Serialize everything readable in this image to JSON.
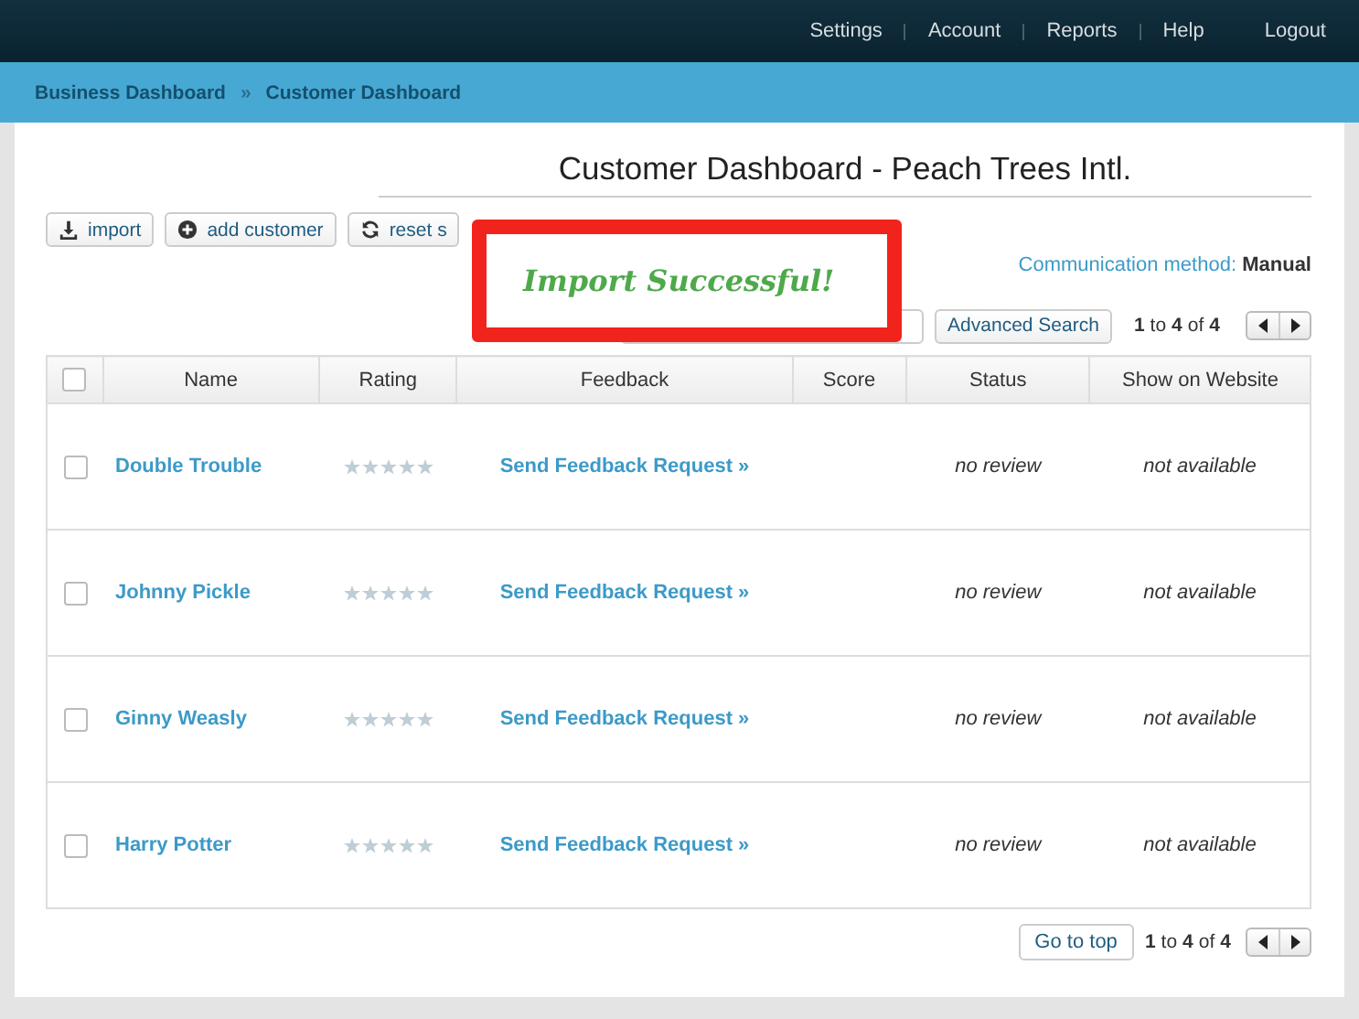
{
  "top_nav": [
    "Settings",
    "Account",
    "Reports",
    "Help",
    "Logout"
  ],
  "breadcrumb": [
    "Business Dashboard",
    "»",
    "Customer Dashboard"
  ],
  "title": "Customer Dashboard - Peach Trees Intl.",
  "toolbar": [
    {
      "label": "import",
      "kind": "download"
    },
    {
      "label": "add customer",
      "kind": "plus"
    },
    {
      "label": "reset s",
      "kind": "refresh"
    }
  ],
  "communication": {
    "label": "Communication method:",
    "value": "Manual"
  },
  "notification": "Import Successful!",
  "advanced_search": "Advanced Search",
  "pagination": {
    "from": "1",
    "to_word": "to",
    "to": "4",
    "of_word": "of",
    "total": "4"
  },
  "table": {
    "select_all": {
      "checked": false
    },
    "columns": [
      "Name",
      "Rating",
      "Feedback",
      "Score",
      "Status",
      "Show on Website"
    ],
    "rows": [
      {
        "checked": false,
        "name": "Double Trouble",
        "stars": 0,
        "feedback": "Send Feedback Request »",
        "status": "no review",
        "website": "not available"
      },
      {
        "checked": false,
        "name": "Johnny Pickle",
        "stars": 0,
        "feedback": "Send Feedback Request »",
        "status": "no review",
        "website": "not available"
      },
      {
        "checked": false,
        "name": "Ginny Weasly",
        "stars": 0,
        "feedback": "Send Feedback Request »",
        "status": "no review",
        "website": "not available"
      },
      {
        "checked": false,
        "name": "Harry Potter",
        "stars": 0,
        "feedback": "Send Feedback Request »",
        "status": "no review",
        "website": "not available"
      }
    ]
  },
  "go_to_top": "Go to top",
  "bottom_pagination": {
    "from": "1",
    "to_word": "to",
    "to": "4",
    "of_word": "of",
    "total": "4"
  }
}
